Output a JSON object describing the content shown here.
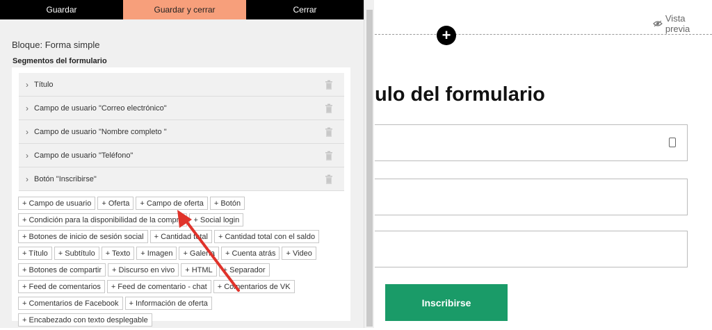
{
  "toolbar": {
    "save_label": "Guardar",
    "save_close_label": "Guardar y cerrar",
    "close_label": "Cerrar"
  },
  "block": {
    "title": "Bloque: Forma simple"
  },
  "segments": {
    "heading": "Segmentos del formulario",
    "items": [
      {
        "label": "Título"
      },
      {
        "label": "Campo de usuario \"Correo electrónico\""
      },
      {
        "label": "Campo de usuario \"Nombre completo \""
      },
      {
        "label": "Campo de usuario \"Teléfono\""
      },
      {
        "label": "Botón \"Inscribirse\""
      }
    ]
  },
  "add_buttons": [
    "+ Campo de usuario",
    "+ Oferta",
    "+ Campo de oferta",
    "+ Botón",
    "+ Condición para la disponibilidad de la compra",
    "+ Social login",
    "+ Botones de inicio de sesión social",
    "+ Cantidad total",
    "+ Cantidad total con el saldo",
    "+ Título",
    "+ Subtítulo",
    "+ Texto",
    "+ Imagen",
    "+ Galería",
    "+ Cuenta atrás",
    "+ Video",
    "+ Botones de compartir",
    "+ Discurso en vivo",
    "+ HTML",
    "+ Separador",
    "+ Feed de comentarios",
    "+ Feed de comentario - chat",
    "+ Comentarios de VK",
    "+ Comentarios de Facebook",
    "+ Información de oferta",
    "+ Encabezado con texto desplegable"
  ],
  "preview": {
    "link_label": "Vista previa",
    "form_title": "ulo del formulario",
    "submit_label": "Inscribirse"
  },
  "colors": {
    "accent": "#f79f7b",
    "submit": "#1a9b68",
    "annotation_arrow": "#e0332b"
  },
  "icons": [
    "chevron-right-icon",
    "trash-icon",
    "eye-icon",
    "plus-icon",
    "contact-card-icon"
  ]
}
